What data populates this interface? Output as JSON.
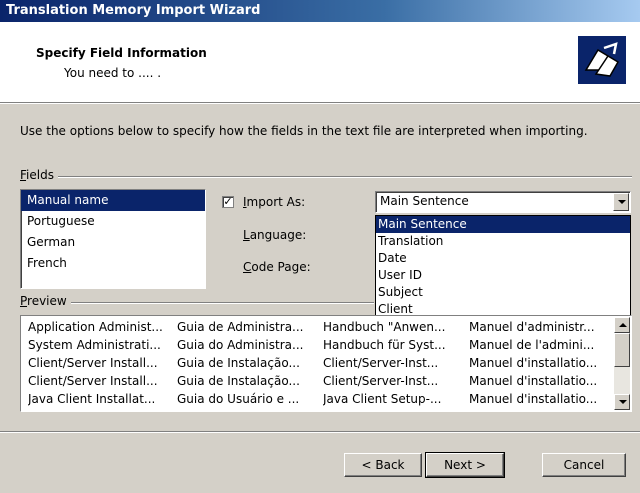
{
  "window": {
    "title": "Translation Memory Import Wizard"
  },
  "header": {
    "title": "Specify Field Information",
    "subtitle": "You need to .... ."
  },
  "instructions": "Use the options below to specify how the fields in the text file are interpreted when importing.",
  "fields": {
    "group_label": "Fields",
    "items": [
      "Manual name",
      "Portuguese",
      "German",
      "French"
    ],
    "selected_index": 0
  },
  "options": {
    "import_as_checked": true,
    "import_as_label": "Import As:",
    "import_as_value": "Main Sentence",
    "language_label": "Language:",
    "code_page_label": "Code Page:",
    "dropdown_options": [
      "Main Sentence",
      "Translation",
      "Date",
      "User ID",
      "Subject",
      "Client"
    ],
    "dropdown_selected_index": 0
  },
  "preview": {
    "group_label": "Preview",
    "rows": [
      [
        "Application Administ...",
        "Guia de Administra...",
        "Handbuch \"Anwen...",
        "Manuel d'administr..."
      ],
      [
        "System Administrati...",
        "Guia do Administra...",
        "Handbuch für Syst...",
        "Manuel de l'admini..."
      ],
      [
        "Client/Server Install...",
        "Guia de Instalação...",
        "Client/Server-Inst...",
        "Manuel d'installatio..."
      ],
      [
        "Client/Server Install...",
        "Guia de Instalação...",
        "Client/Server-Inst...",
        "Manuel d'installatio..."
      ],
      [
        "Java Client Installat...",
        "Guia do Usuário e ...",
        "Java Client Setup-...",
        "Manuel d'installatio..."
      ]
    ]
  },
  "buttons": {
    "back": "< Back",
    "next": "Next >",
    "cancel": "Cancel"
  }
}
